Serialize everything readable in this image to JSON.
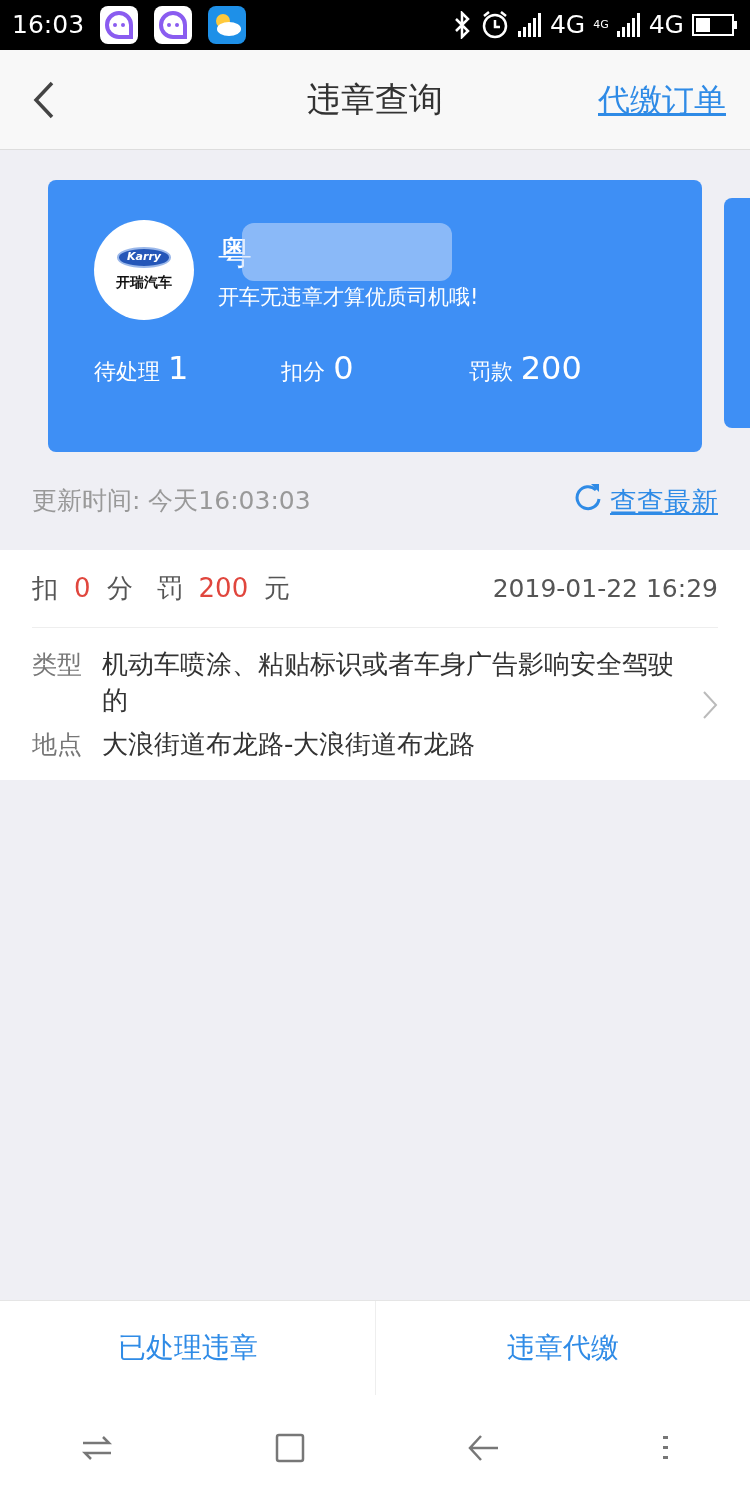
{
  "status_bar": {
    "time": "16:03",
    "network_1": "4G",
    "network_2_label": "4G",
    "network_2": "4G"
  },
  "header": {
    "title": "违章查询",
    "action": "代缴订单"
  },
  "car_card": {
    "brand_mark": "Karry",
    "brand_name": "开瑞汽车",
    "plate": "粤",
    "slogan": "开车无违章才算优质司机哦!",
    "stats": [
      {
        "label": "待处理",
        "value": "1"
      },
      {
        "label": "扣分",
        "value": "0"
      },
      {
        "label": "罚款",
        "value": "200"
      }
    ]
  },
  "update": {
    "text": "更新时间: 今天16:03:03",
    "refresh": "查查最新"
  },
  "violations": [
    {
      "deduct_label": "扣",
      "points": "0",
      "points_unit": "分",
      "fine_label": "罚",
      "fine": "200",
      "fine_unit": "元",
      "time": "2019-01-22 16:29",
      "type_label": "类型",
      "type": "机动车喷涂、粘贴标识或者车身广告影响安全驾驶的",
      "place_label": "地点",
      "place": "大浪街道布龙路-大浪街道布龙路"
    }
  ],
  "bottom_tabs": [
    "已处理违章",
    "违章代缴"
  ]
}
